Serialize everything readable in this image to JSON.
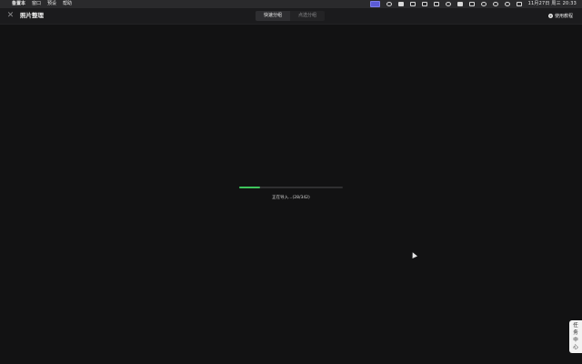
{
  "menubar": {
    "apple": "",
    "app_name": "备置本",
    "menus": [
      "窗口",
      "预设",
      "帮助"
    ],
    "clock": "11月27日 周三 20:33",
    "tray_icons": [
      "screen-share-icon",
      "circle-icon",
      "brush-icon",
      "shape-icon",
      "layout-icon",
      "cloud-icon",
      "wechat-icon",
      "window-icon",
      "control-icon",
      "wifi-icon",
      "search-icon",
      "user-icon",
      "toggle-icon"
    ]
  },
  "titlebar": {
    "title": "照片整理",
    "tabs": [
      {
        "label": "快速分组",
        "active": true
      },
      {
        "label": "点选分组",
        "active": false
      }
    ],
    "tutorial_label": "使用教程",
    "tutorial_icon": "+"
  },
  "close_glyph": "✕",
  "progress": {
    "text": "正在导入...(28/342)",
    "current": 28,
    "total": 342,
    "fill_fraction": 0.2,
    "color": "#3ec45b"
  },
  "task_center": {
    "chars": [
      "任",
      "务",
      "中",
      "心"
    ]
  }
}
